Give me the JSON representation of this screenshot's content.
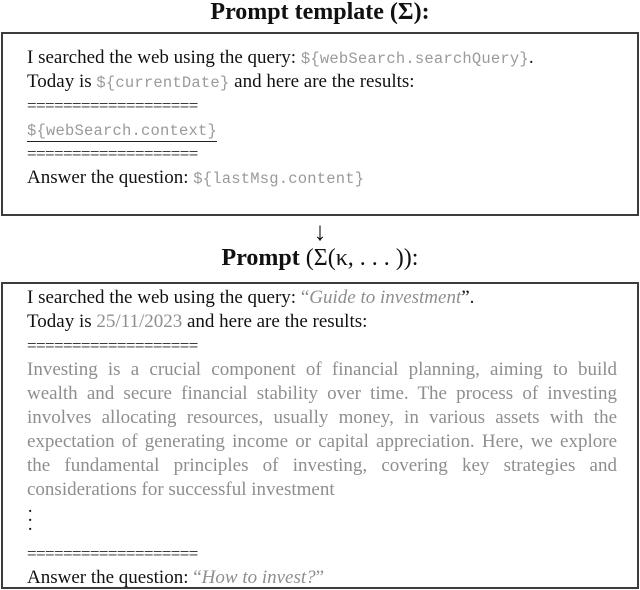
{
  "template_panel": {
    "title": "Prompt template",
    "title_symbol": "(Σ):",
    "line1_prefix": "I searched the web using the query: ",
    "line1_var": "${webSearch.searchQuery}",
    "line1_suffix": ".",
    "line2_prefix": "Today is ",
    "line2_var": "${currentDate}",
    "line2_suffix": " and here are the results:",
    "separator": "===================",
    "context_var": "${webSearch.context}",
    "separator_end": "===================",
    "answer_prefix": "Answer the question: ",
    "answer_var": "${lastMsg.content}"
  },
  "arrow": {
    "icon": "arrow-down-icon",
    "glyph": "↓"
  },
  "prompt_panel": {
    "title": "Prompt",
    "title_symbol": "(Σ(κ, . . . )):",
    "line1_prefix": "I searched the web using the query: ",
    "line1_open_quote": "“",
    "line1_value": "Guide to investment",
    "line1_close_quote": "”.",
    "line2_prefix": "Today is ",
    "line2_value": "25/11/2023",
    "line2_suffix": " and here are the results:",
    "separator": "===================",
    "context_text": "Investing is a crucial component of financial planning, aiming to build wealth and secure financial stability over time. The process of investing involves allocating resources, usually money, in various assets with the expectation of generating income or capital appreciation. Here, we explore the fundamental principles of investing, covering key strategies and considerations for successful investment",
    "ellipsis": [
      "·",
      "·",
      "·"
    ],
    "separator_end": "===================",
    "answer_prefix": "Answer the question: ",
    "answer_open_quote": "“",
    "answer_value": "How to invest?",
    "answer_close_quote": "”"
  }
}
